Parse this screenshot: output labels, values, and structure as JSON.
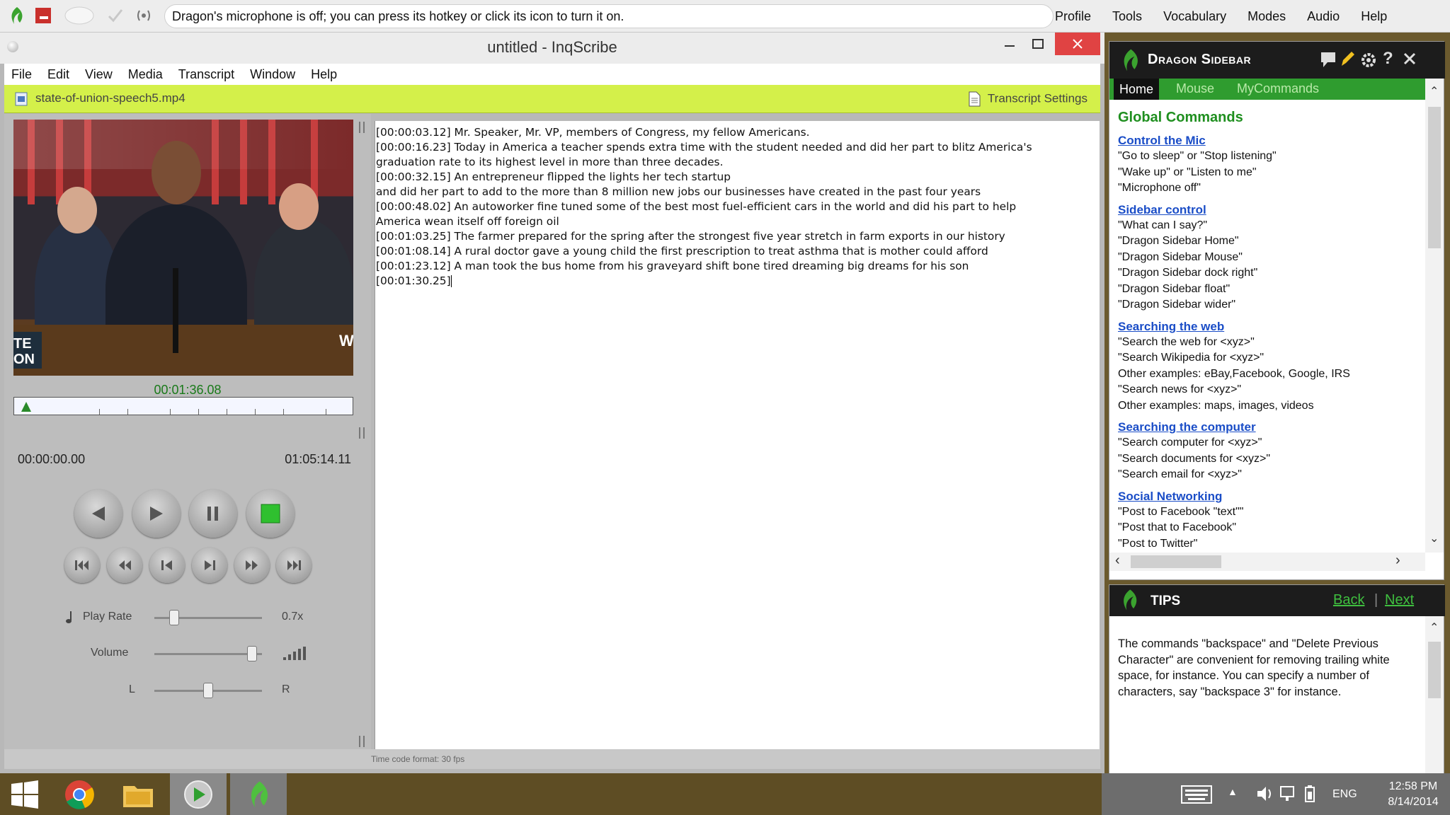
{
  "dragon_bar": {
    "message": "Dragon's microphone is off; you can press its hotkey or click its icon to turn it on.",
    "menu": [
      "Profile",
      "Tools",
      "Vocabulary",
      "Modes",
      "Audio",
      "Help"
    ]
  },
  "inqscribe": {
    "title": "untitled - InqScribe",
    "menu": [
      "File",
      "Edit",
      "View",
      "Media",
      "Transcript",
      "Window",
      "Help"
    ],
    "media_file": "state-of-union-speech5.mp4",
    "transcript_settings": "Transcript Settings",
    "current_time": "00:01:36.08",
    "start_time": "00:00:00.00",
    "end_time": "01:05:14.11",
    "play_rate_label": "Play Rate",
    "play_rate_value": "0.7x",
    "play_rate_level": 0.15,
    "volume_label": "Volume",
    "volume_level": 0.95,
    "balance_left": "L",
    "balance_right": "R",
    "balance_level": 0.5,
    "playhead_fraction": 0.025,
    "video_overlay_text": [
      "TE",
      "ON",
      "W"
    ],
    "transcript_lines": [
      "[00:00:03.12] Mr. Speaker, Mr. VP, members of Congress, my fellow Americans.",
      "[00:00:16.23] Today in America a teacher spends extra time with the student needed and did her part to blitz America's",
      "graduation rate to its highest level in more than three decades.",
      "[00:00:32.15] An entrepreneur flipped the lights her tech startup",
      "and did her part to add to the more than 8 million new jobs our businesses have created in the past four years",
      "[00:00:48.02] An autoworker fine tuned some of the best most fuel-efficient cars in the world and did his part to help",
      "America wean itself off foreign oil",
      "[00:01:03.25] The farmer prepared for the spring after the strongest five year stretch in farm exports in our history",
      "[00:01:08.14] A rural doctor gave a young child the first prescription to treat asthma that is mother could afford",
      "[00:01:23.12] A man took the bus home from his graveyard shift bone tired dreaming big dreams for his son",
      "[00:01:30.25]"
    ],
    "status": "Time code format: 30 fps"
  },
  "sidebar": {
    "title": "Dragon Sidebar",
    "tabs": [
      "Home",
      "Mouse",
      "MyCommands"
    ],
    "heading": "Global Commands",
    "sections": [
      {
        "title": "Control the Mic",
        "lines": [
          "\"Go to sleep\" or \"Stop listening\"",
          "\"Wake up\" or \"Listen to me\"",
          "\"Microphone off\""
        ]
      },
      {
        "title": "Sidebar control",
        "lines": [
          "\"What can I say?\"",
          "\"Dragon Sidebar Home\"",
          "\"Dragon Sidebar Mouse\"",
          "\"Dragon Sidebar dock right\"",
          "\"Dragon Sidebar float\"",
          "\"Dragon Sidebar wider\""
        ]
      },
      {
        "title": "Searching the web",
        "lines": [
          "\"Search the web for <xyz>\"",
          "\"Search Wikipedia for <xyz>\"",
          "Other examples: eBay,Facebook, Google, IRS",
          "\"Search news for <xyz>\"",
          "Other examples: maps, images, videos"
        ]
      },
      {
        "title": "Searching the computer",
        "lines": [
          "\"Search computer for <xyz>\"",
          "\"Search documents for <xyz>\"",
          "\"Search email for <xyz>\""
        ]
      },
      {
        "title": "Social Networking",
        "lines": [
          "\"Post to Facebook \"text\"\"",
          "\"Post that to Facebook\"",
          "\"Post to Twitter\""
        ]
      }
    ]
  },
  "tips": {
    "title": "TIPS",
    "back": "Back",
    "next": "Next",
    "text": "The commands \"backspace\" and \"Delete Previous Character\" are convenient for removing trailing white space, for instance. You can specify a number of characters, say \"backspace 3\" for instance."
  },
  "taskbar": {
    "language": "ENG",
    "time": "12:58 PM",
    "date": "8/14/2014"
  }
}
